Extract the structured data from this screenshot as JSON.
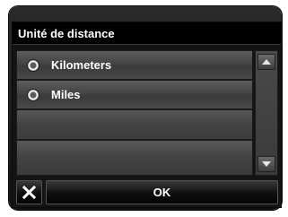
{
  "dialog": {
    "title": "Unité de distance",
    "options": [
      {
        "label": "Kilometers",
        "selected": false
      },
      {
        "label": "Miles",
        "selected": false
      }
    ],
    "ok_label": "OK",
    "close_icon": "close-icon",
    "scroll_up_icon": "arrow-up-icon",
    "scroll_down_icon": "arrow-down-icon"
  },
  "colors": {
    "title_bg": "#000000",
    "row_bg": "#4a4a4a",
    "text": "#ffffff"
  }
}
